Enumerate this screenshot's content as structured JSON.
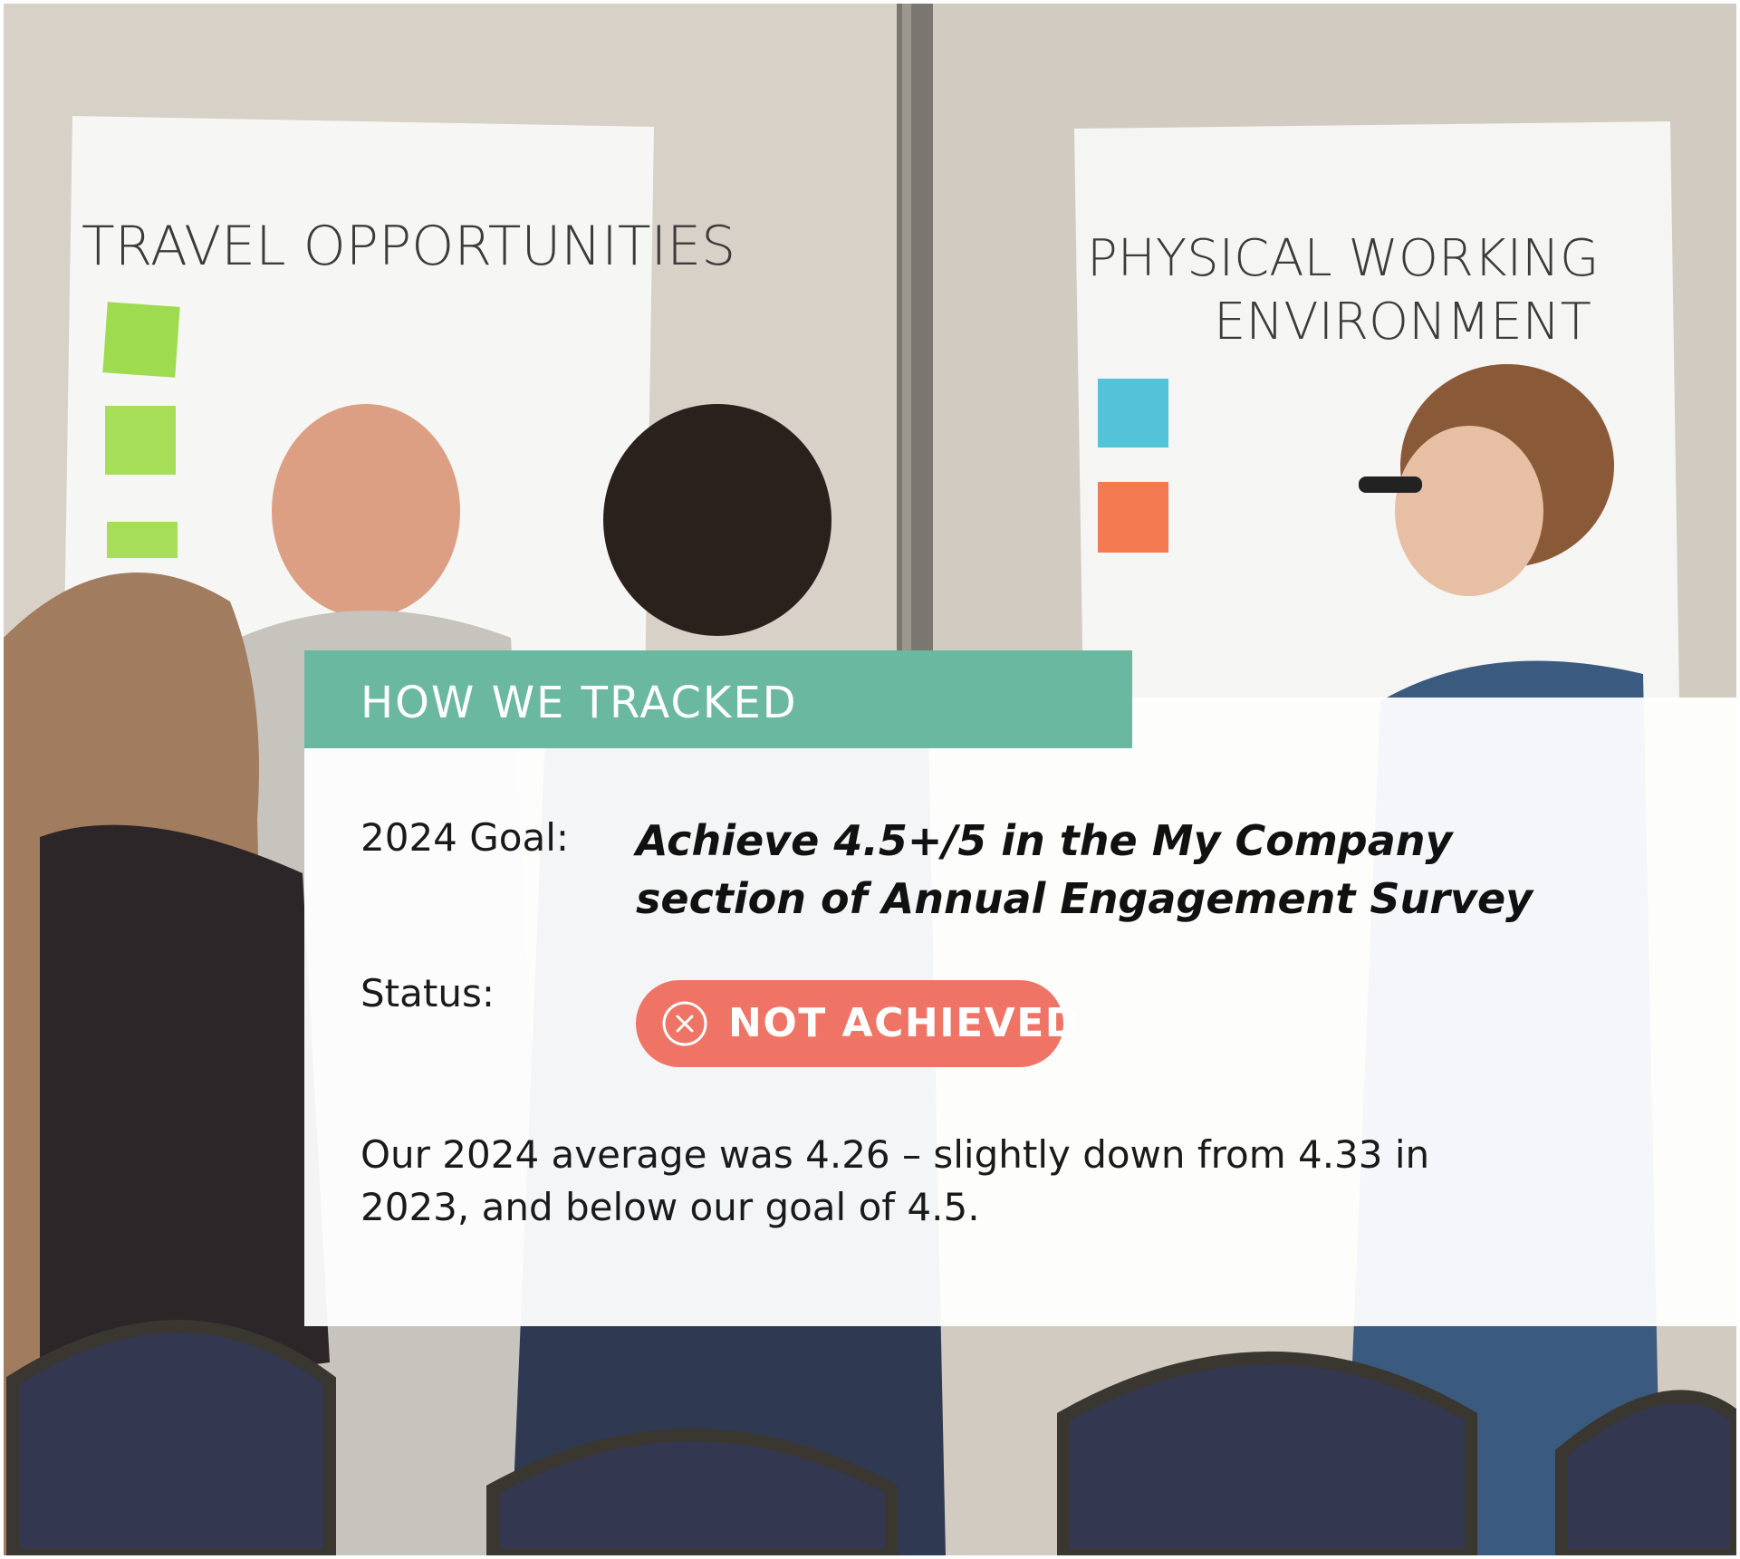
{
  "photo": {
    "poster_left_heading": "TRAVEL OPPORTUNITIES",
    "poster_right_heading_line1": "PHYSICAL WORKING",
    "poster_right_heading_line2": "ENVIRONMENT"
  },
  "panel": {
    "heading": "HOW WE TRACKED",
    "goal_label": "2024 Goal:",
    "goal_text": "Achieve 4.5+/5 in the My Company section of Annual Engagement Survey",
    "status_label": "Status:",
    "status_value": "NOT ACHIEVED",
    "summary": "Our 2024 average was 4.26 – slightly down from 4.33 in 2023, and below our goal of 4.5."
  },
  "colors": {
    "header_band": "#6bb8a0",
    "status_badge": "#f07466"
  },
  "icons": {
    "status_icon": "close-circle-icon"
  }
}
